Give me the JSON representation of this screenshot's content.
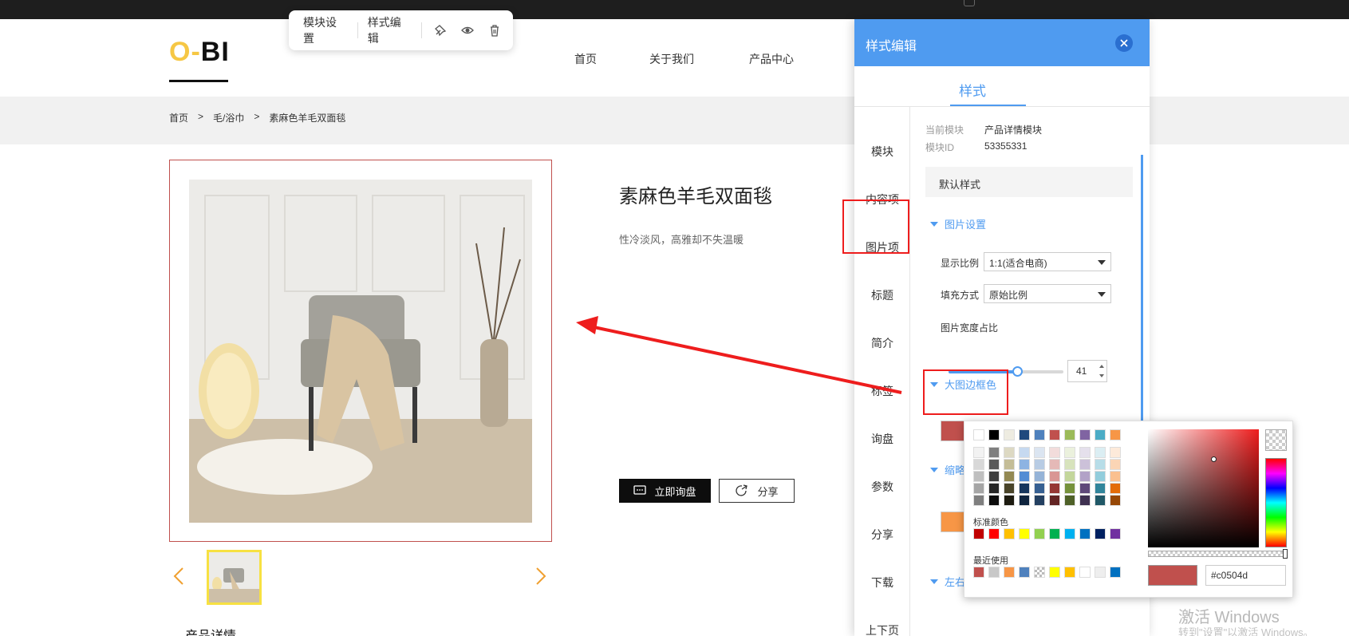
{
  "site": {
    "logo": {
      "o": "O",
      "dash": "-",
      "bi": "BI"
    },
    "nav": [
      {
        "label": "首页"
      },
      {
        "label": "关于我们"
      },
      {
        "label": "产品中心"
      }
    ],
    "breadcrumb": [
      "首页",
      ">",
      "毛/浴巾",
      ">",
      "素麻色羊毛双面毯"
    ]
  },
  "toolbar": {
    "module_settings": "模块设置",
    "style_edit": "样式编辑"
  },
  "product": {
    "title": "素麻色羊毛双面毯",
    "subtitle": "性冷淡风，高雅却不失温暖",
    "inquiry_label": "立即询盘",
    "share_label": "分享",
    "detail_heading": "产品详情"
  },
  "panel": {
    "title": "样式编辑",
    "tab": "样式",
    "menu": [
      "模块",
      "内容项",
      "图片项",
      "标题",
      "简介",
      "标签",
      "询盘",
      "参数",
      "分享",
      "下载",
      "上下页"
    ],
    "current_module_label": "当前模块",
    "current_module_value": "产品详情模块",
    "module_id_label": "模块ID",
    "module_id_value": "53355331",
    "default_style": "默认样式",
    "image_settings": "图片设置",
    "ratio_label": "显示比例",
    "ratio_value": "1:1(适合电商)",
    "fill_label": "填充方式",
    "fill_value": "原始比例",
    "width_label": "图片宽度占比",
    "width_value": "41",
    "border_color_section": "大图边框色",
    "thumb_section_partial": "缩略",
    "lr_section_partial": "左右"
  },
  "color_picker": {
    "standard_label": "标准颜色",
    "recent_label": "最近使用",
    "hex_value": "#c0504d",
    "theme_top": [
      "#ffffff",
      "#000000",
      "#eeece1",
      "#1f497d",
      "#4f81bd",
      "#c0504d",
      "#9bbb59",
      "#8064a2",
      "#4bacc6",
      "#f79646"
    ],
    "theme_shades": [
      [
        "#f2f2f2",
        "#7f7f7f",
        "#ddd9c3",
        "#c6d9f0",
        "#dbe5f1",
        "#f2dcdb",
        "#ebf1dd",
        "#e5e0ec",
        "#dbeef3",
        "#fdeada"
      ],
      [
        "#d8d8d8",
        "#595959",
        "#c4bd97",
        "#8db3e2",
        "#b8cce4",
        "#e5b9b7",
        "#d7e3bc",
        "#ccc1d9",
        "#b7dde8",
        "#fbd5b5"
      ],
      [
        "#bfbfbf",
        "#3f3f3f",
        "#938953",
        "#548dd4",
        "#95b3d7",
        "#d99694",
        "#c3d69b",
        "#b2a2c7",
        "#92cddc",
        "#fac08f"
      ],
      [
        "#a5a5a5",
        "#262626",
        "#494429",
        "#17365d",
        "#366092",
        "#953734",
        "#76923c",
        "#5f497a",
        "#31859b",
        "#e36c09"
      ],
      [
        "#7f7f7f",
        "#0c0c0c",
        "#1d1b10",
        "#0f243e",
        "#244061",
        "#632423",
        "#4f6128",
        "#3f3151",
        "#205867",
        "#974806"
      ]
    ],
    "standard": [
      "#c00000",
      "#ff0000",
      "#ffc000",
      "#ffff00",
      "#92d050",
      "#00b050",
      "#00b0f0",
      "#0070c0",
      "#002060",
      "#7030a0"
    ],
    "recent": [
      "#c0504d",
      "#c8c8c8",
      "#f79646",
      "#4f81bd",
      "checker",
      "#ffff00",
      "#ffc000",
      "#ffffff",
      "#eeeeee",
      "#0070c0"
    ]
  },
  "watermark": {
    "line1": "激活 Windows",
    "line2": "转到\"设置\"以激活 Windows。"
  },
  "colors": {
    "accent": "#4f9bf0",
    "highlight": "#ee1d1d",
    "border_color": "#c0504d"
  }
}
